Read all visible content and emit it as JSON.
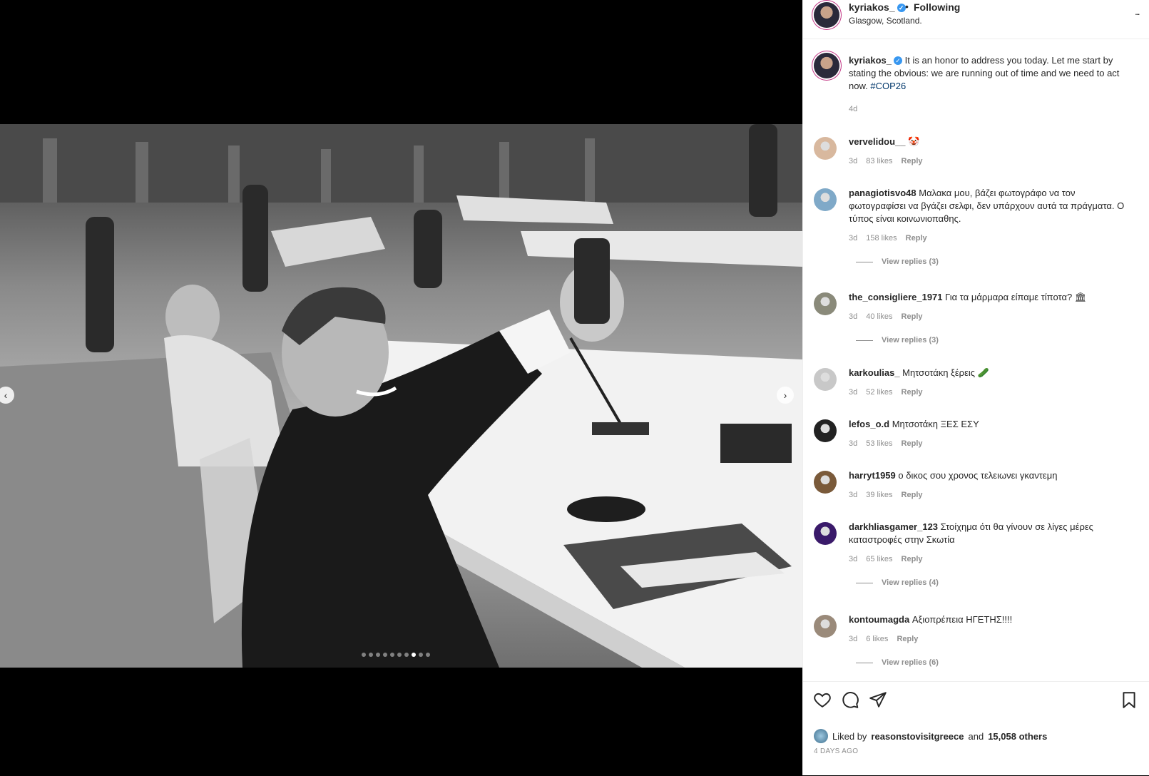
{
  "post": {
    "username": "kyriakos_",
    "follow_dot": "•",
    "follow_status": "Following",
    "location": "Glasgow, Scotland.",
    "more": "..."
  },
  "caption": {
    "username": "kyriakos_",
    "text": "It is an honor to address you today. Let me start by stating the obvious: we are running out of time and we need to act now.",
    "hashtag": "#COP26",
    "time": "4d"
  },
  "comments": [
    {
      "user": "vervelidou__",
      "text": "🤡",
      "time": "3d",
      "likes": "83 likes",
      "reply": "Reply",
      "avatar_color": "#d8b89e"
    },
    {
      "user": "panagiotisvo48",
      "text": "Μαλακα μου, βάζει φωτογράφο να τον φωτογραφίσει να βγάζει σελφι, δεν υπάρχουν αυτά τα πράγματα. Ο τύπος είναι κοινωνιοπαθης.",
      "time": "3d",
      "likes": "158 likes",
      "reply": "Reply",
      "view_replies": "View replies (3)",
      "avatar_color": "#7fa9c8"
    },
    {
      "user": "the_consigliere_1971",
      "text": "Για τα μάρμαρα είπαμε τίποτα? 🏛",
      "time": "3d",
      "likes": "40 likes",
      "reply": "Reply",
      "view_replies": "View replies (3)",
      "avatar_color": "#8a8a7a"
    },
    {
      "user": "karkoulias_",
      "text": "Μητσοτάκη ξέρεις 🥒",
      "time": "3d",
      "likes": "52 likes",
      "reply": "Reply",
      "avatar_color": "#c8c8c8"
    },
    {
      "user": "lefos_o.d",
      "text": "Μητσοτάκη ΞΕΣ ΕΣΥ",
      "time": "3d",
      "likes": "53 likes",
      "reply": "Reply",
      "avatar_color": "#222222"
    },
    {
      "user": "harryt1959",
      "text": "ο δικος σου χρονος τελειωνει γκαντεμη",
      "time": "3d",
      "likes": "39 likes",
      "reply": "Reply",
      "avatar_color": "#7a5a3a"
    },
    {
      "user": "darkhliasgamer_123",
      "text": "Στοίχημα ότι θα γίνουν σε λίγες μέρες καταστροφές στην Σκωτία",
      "time": "3d",
      "likes": "65 likes",
      "reply": "Reply",
      "view_replies": "View replies (4)",
      "avatar_color": "#3a1a6a"
    },
    {
      "user": "kontoumagda",
      "text": "Αξιοπρέπεια ΗΓΕΤΗΣ!!!!",
      "time": "3d",
      "likes": "6 likes",
      "reply": "Reply",
      "view_replies": "View replies (6)",
      "avatar_color": "#9a8a7a"
    }
  ],
  "actions": {
    "like_icon": "heart-icon",
    "comment_icon": "comment-icon",
    "share_icon": "paper-plane-icon",
    "save_icon": "bookmark-icon"
  },
  "likes": {
    "prefix": "Liked by",
    "user": "reasonstovisitgreece",
    "and": "and",
    "others": "15,058 others",
    "date": "4 DAYS AGO"
  },
  "carousel": {
    "total": 10,
    "active": 8
  },
  "colors": {
    "link": "#00376b",
    "muted": "#8e8e8e",
    "verified": "#3897f0",
    "ring": "#c13584"
  }
}
